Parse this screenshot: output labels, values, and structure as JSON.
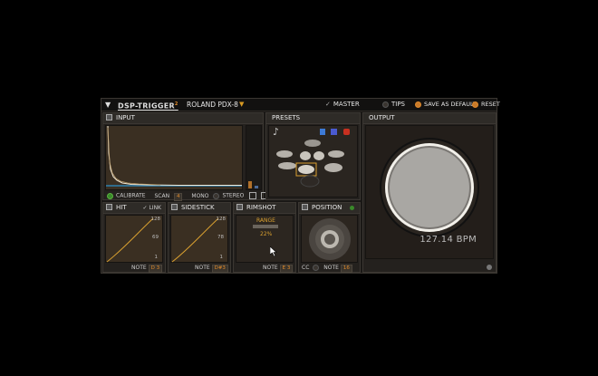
{
  "topbar": {
    "menu_arrow": "▼",
    "logo": "DSP-TRIGGER",
    "logo_mark": "2",
    "preset_name": "ROLAND PDX-8",
    "preset_arrow": "▼",
    "master_check": "✓",
    "master_label": "MASTER",
    "tips_label": "TIPS",
    "save_default_label": "SAVE AS DEFAULT",
    "reset_label": "RESET"
  },
  "input": {
    "title": "INPUT",
    "calibrate_label": "CALIBRATE",
    "scan_label": "SCAN",
    "scan_value": "4",
    "mono_label": "MONO",
    "stereo_label": "STEREO"
  },
  "presets": {
    "title": "PRESETS",
    "note_icon": "♪"
  },
  "output": {
    "title": "OUTPUT",
    "bpm": "127.14 BPM"
  },
  "hit": {
    "title": "HIT",
    "link_label": "✓ LINK",
    "scale_top": "128",
    "scale_mid": "69",
    "scale_bot": "1",
    "note_label": "NOTE",
    "note_value": "D 3"
  },
  "sidestick": {
    "title": "SIDESTICK",
    "scale_top": "128",
    "scale_mid": "78",
    "scale_bot": "1",
    "note_label": "NOTE",
    "note_value": "D#3"
  },
  "rimshot": {
    "title": "RIMSHOT",
    "range_label": "RANGE",
    "range_value": "22%",
    "note_label": "NOTE",
    "note_value": "E 3"
  },
  "position": {
    "title": "POSITION",
    "cc_label": "CC",
    "note_label": "NOTE",
    "note_value": "16"
  },
  "colors": {
    "accent": "#e08a2b",
    "panel": "#24211e",
    "screen": "#3a2f22"
  }
}
